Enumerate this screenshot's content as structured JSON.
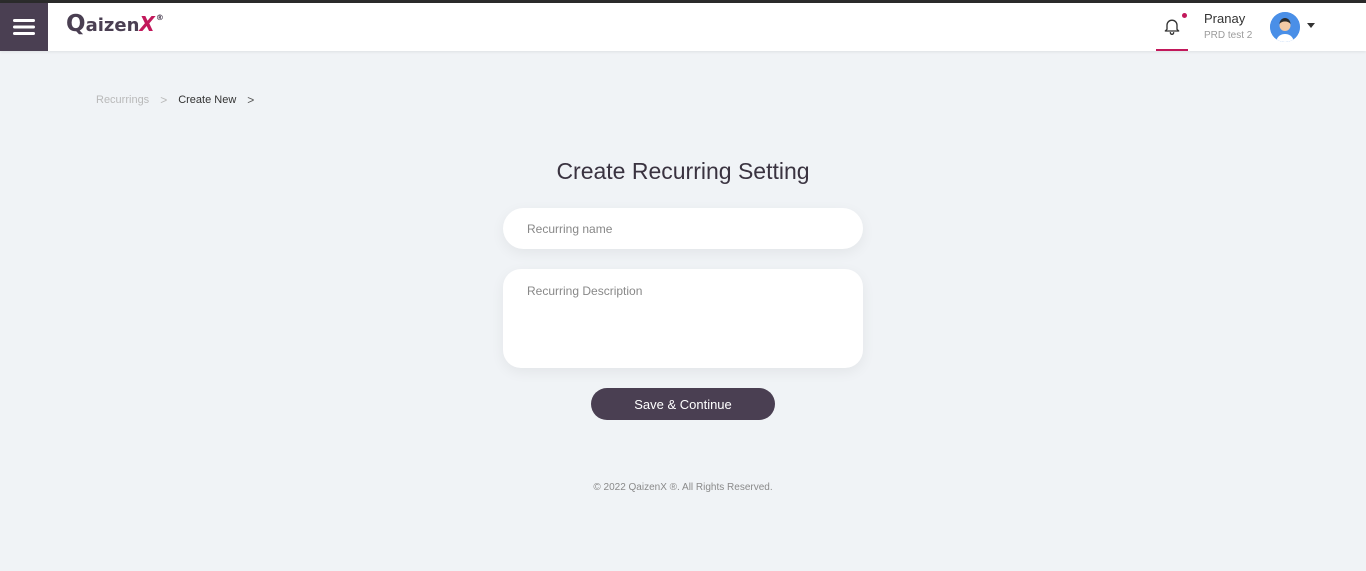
{
  "header": {
    "logo": {
      "q": "Q",
      "rest": "aizen",
      "x": "X",
      "reg": "®"
    },
    "user": {
      "name": "Pranay",
      "subtitle": "PRD test 2"
    }
  },
  "breadcrumb": {
    "items": [
      "Recurrings",
      "Create New"
    ],
    "separator": ">"
  },
  "form": {
    "title": "Create Recurring Setting",
    "name_placeholder": "Recurring name",
    "name_value": "",
    "description_placeholder": "Recurring Description",
    "description_value": "",
    "save_label": "Save & Continue"
  },
  "footer": {
    "text": "© 2022 QaizenX ®. All Rights Reserved."
  },
  "icons": {
    "menu": "hamburger-menu-icon",
    "bell": "bell-icon",
    "avatar": "user-avatar",
    "caret": "caret-down-icon"
  },
  "colors": {
    "brand_dark": "#4a3f52",
    "accent": "#c2185b",
    "background": "#f0f3f6"
  }
}
